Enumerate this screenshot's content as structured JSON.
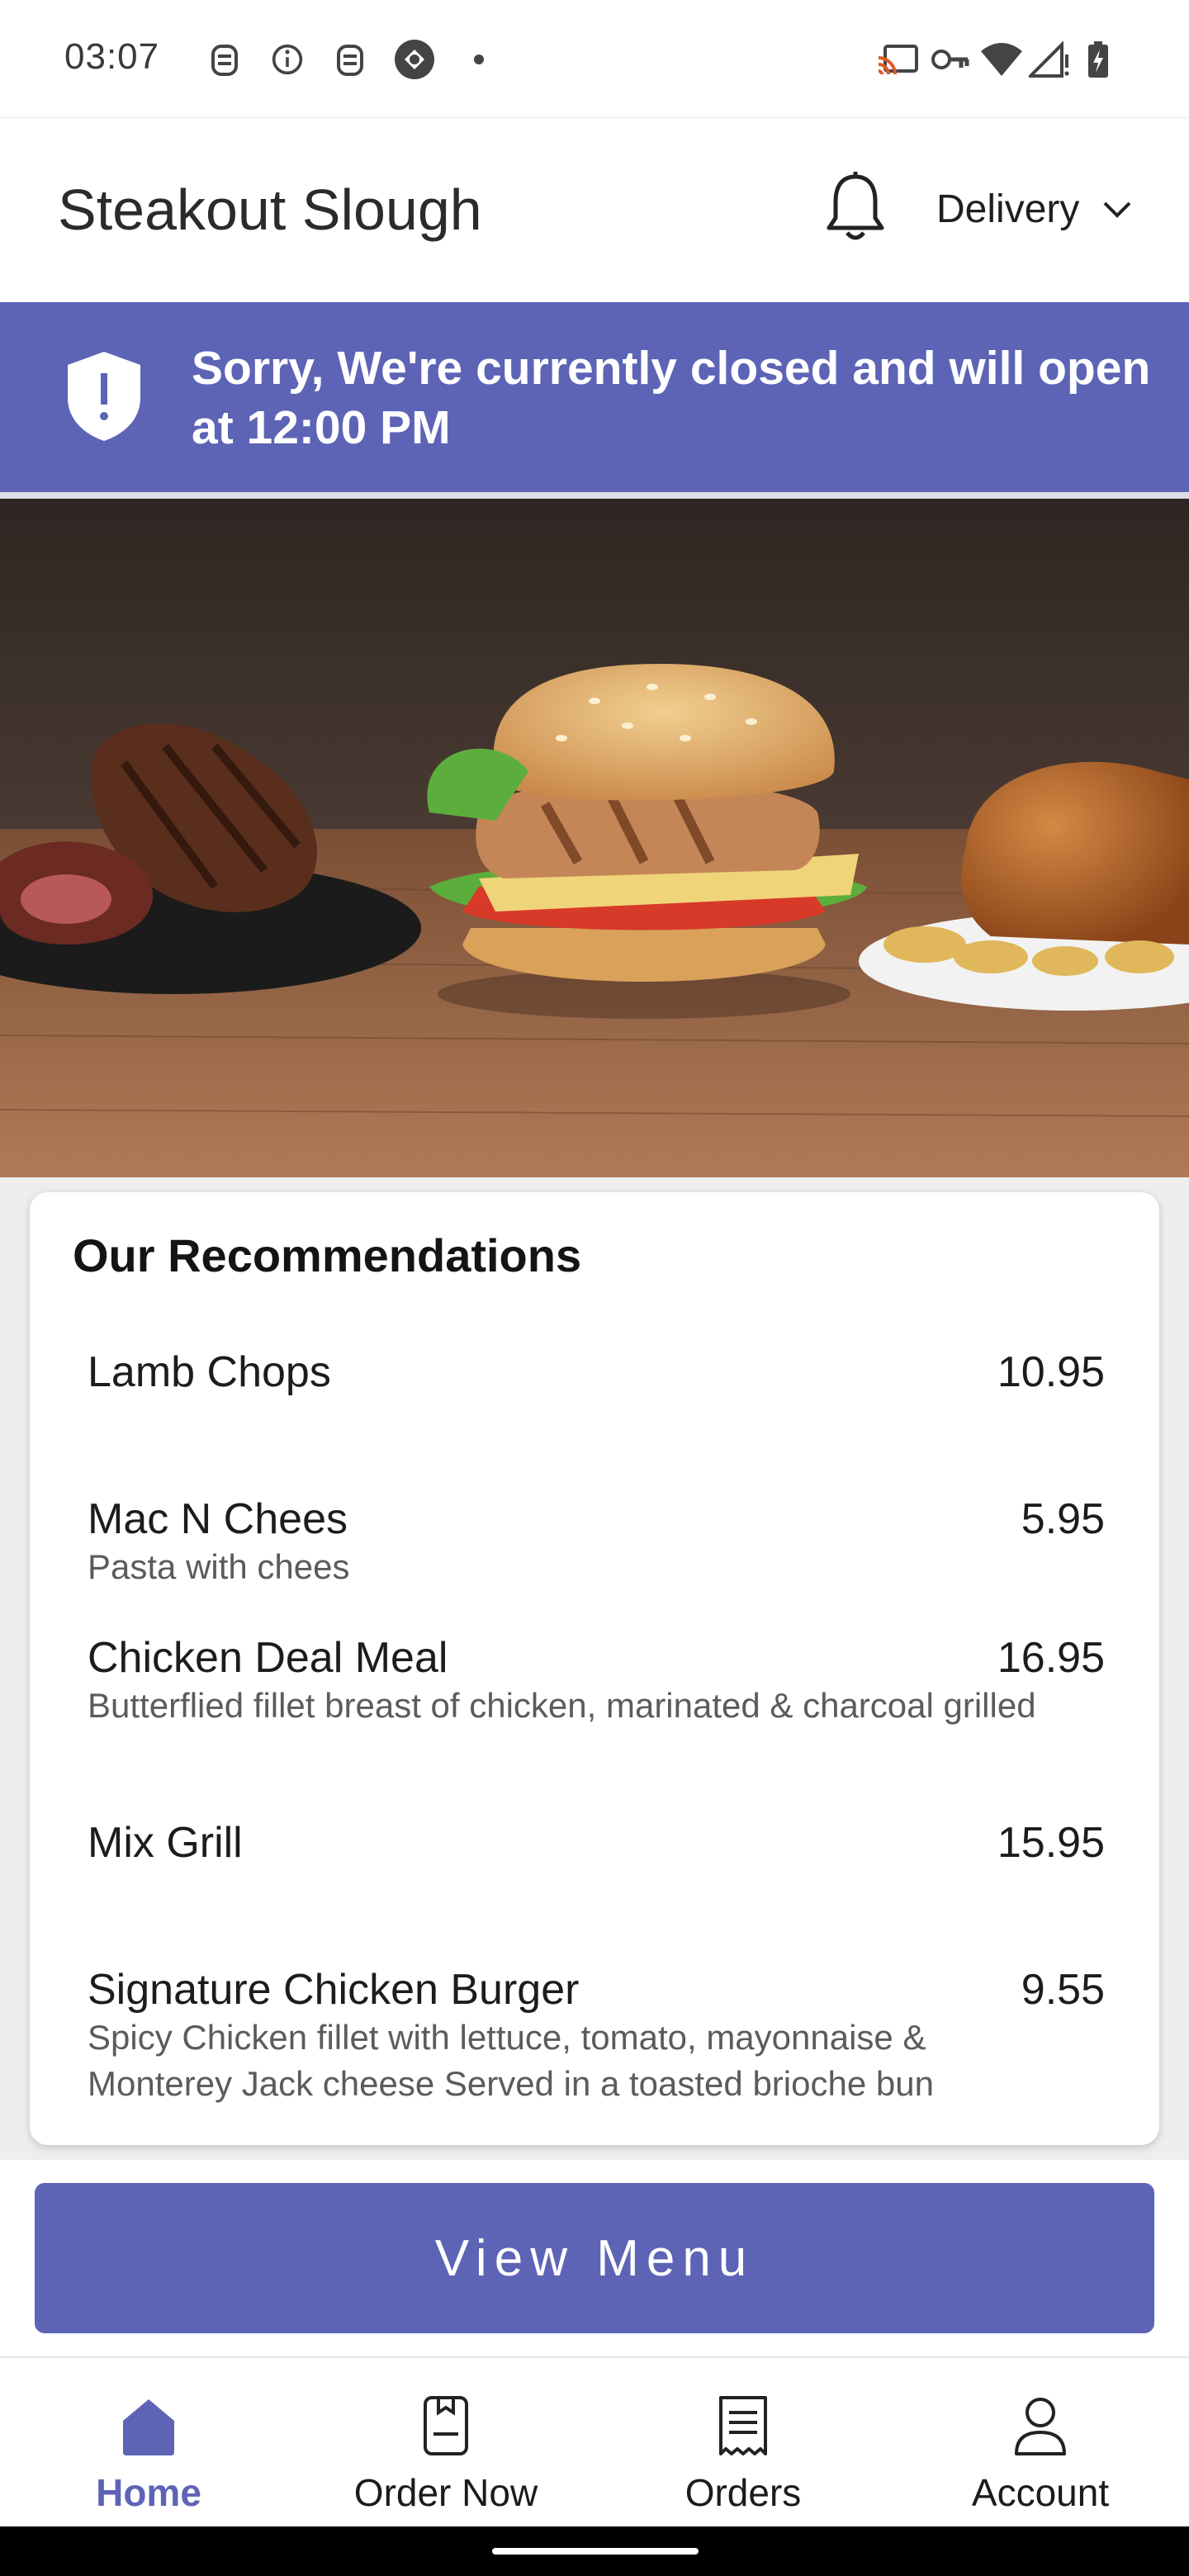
{
  "status_bar": {
    "time": "03:07",
    "left_icons": [
      "notification-icon",
      "info-icon",
      "notification-icon",
      "app-icon",
      "dot-icon"
    ],
    "right_icons": [
      "cast-icon",
      "vpn-key-icon",
      "wifi-icon",
      "cell-signal-icon",
      "battery-charging-icon"
    ]
  },
  "header": {
    "title": "Steakout Slough",
    "bell_icon": "bell-icon",
    "order_mode": "Delivery"
  },
  "banner": {
    "message": "Sorry, We're currently closed and will open at 12:00 PM",
    "icon": "shield-alert-icon",
    "color": "#5d64b6"
  },
  "hero": {
    "icon": "food-hero-image"
  },
  "recommendations": {
    "title": "Our Recommendations",
    "items": [
      {
        "name": "Lamb Chops",
        "price": "10.95",
        "description": ""
      },
      {
        "name": "Mac N Chees",
        "price": "5.95",
        "description": "Pasta with chees"
      },
      {
        "name": "Chicken Deal Meal",
        "price": "16.95",
        "description": "Butterflied fillet breast of chicken, marinated & charcoal grilled"
      },
      {
        "name": "Mix Grill",
        "price": "15.95",
        "description": ""
      },
      {
        "name": "Signature Chicken Burger",
        "price": "9.55",
        "description": "Spicy Chicken fillet with lettuce, tomato, mayonnaise & Monterey Jack cheese  Served in a toasted brioche bun"
      }
    ]
  },
  "view_menu": {
    "label": "View Menu"
  },
  "bottom_nav": {
    "active_color": "#5d64b6",
    "items": [
      {
        "label": "Home",
        "icon": "home-icon",
        "active": true
      },
      {
        "label": "Order Now",
        "icon": "order-icon",
        "active": false
      },
      {
        "label": "Orders",
        "icon": "receipt-icon",
        "active": false
      },
      {
        "label": "Account",
        "icon": "account-icon",
        "active": false
      }
    ]
  }
}
